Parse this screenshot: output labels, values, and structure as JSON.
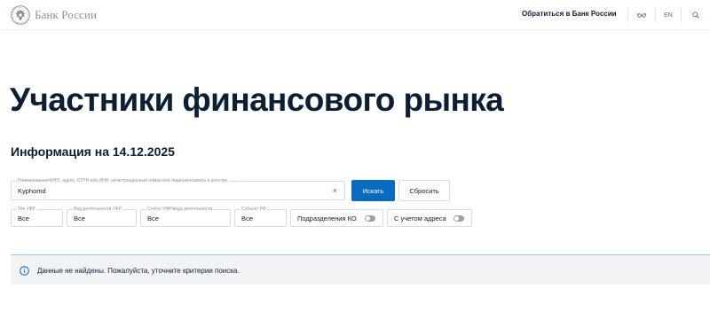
{
  "header": {
    "logo_text": "Банк России",
    "contact_link": "Обратиться в Банк России",
    "language": "EN"
  },
  "page": {
    "title": "Участники финансового рынка",
    "info_date": "Информация на 14.12.2025"
  },
  "search": {
    "label": "Наименование/ФИО, адрес, ОГРН или ИНН, регистрационный номер или лицензия/запись в реестре",
    "value": "Kyphomd",
    "clear_icon": "×",
    "search_button": "Искать",
    "reset_button": "Сбросить"
  },
  "filters": [
    {
      "label": "Тип УФР",
      "value": "Все"
    },
    {
      "label": "Вид деятельности УФР",
      "value": "Все"
    },
    {
      "label": "Статус УФР/вида деятельности",
      "value": "Все"
    },
    {
      "label": "Субъект РФ",
      "value": "Все"
    }
  ],
  "toggles": [
    {
      "label": "Подразделения КО",
      "on": false
    },
    {
      "label": "С учетом адреса",
      "on": false
    }
  ],
  "notice": {
    "text": "Данные не найдены. Пожалуйста, уточните критерии поиска."
  },
  "colors": {
    "primary": "#0a6ac0",
    "text": "#0b1f35",
    "notice_bg": "#f2f3f4"
  }
}
